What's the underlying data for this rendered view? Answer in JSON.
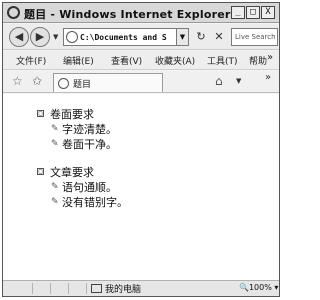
{
  "window": {
    "title": "题目 - Windows Internet Explorer",
    "controls": [
      "_",
      "□",
      "X"
    ]
  },
  "navigation": {
    "back_icon": "back-arrow-icon",
    "forward_icon": "forward-arrow-icon",
    "address": "C:\\Documents and S",
    "refresh_icon": "refresh-icon",
    "stop_icon": "stop-icon",
    "search_placeholder": "Live Search"
  },
  "menubar": {
    "items": [
      "文件(F)",
      "编辑(E)",
      "查看(V)",
      "收藏夹(A)",
      "工具(T)",
      "帮助"
    ],
    "more": "»"
  },
  "tabs": {
    "active_label": "题目",
    "more": "»"
  },
  "content": {
    "groups": [
      {
        "toggle": "□",
        "title": "卷面要求",
        "items": [
          "字迹清楚。",
          "卷面干净。"
        ]
      },
      {
        "toggle": "□",
        "title": "文章要求",
        "items": [
          "语句通顺。",
          "没有错别字。"
        ]
      }
    ]
  },
  "statusbar": {
    "zone": "我的电脑",
    "zoom": "100%"
  }
}
